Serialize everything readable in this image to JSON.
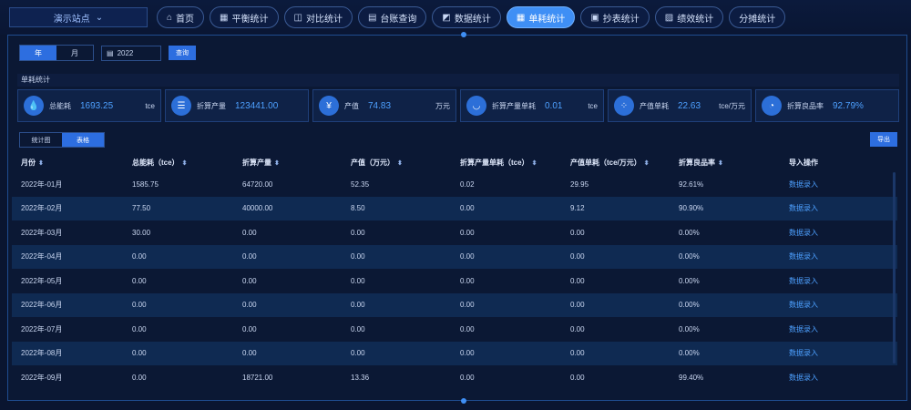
{
  "site": {
    "label": "演示站点",
    "chevron": "chevron-down-icon"
  },
  "nav": [
    {
      "label": "首页",
      "icon": "home-icon",
      "glyph": "⌂",
      "active": false
    },
    {
      "label": "平衡统计",
      "icon": "grid-icon",
      "glyph": "▦",
      "active": false
    },
    {
      "label": "对比统计",
      "icon": "compare-icon",
      "glyph": "◫",
      "active": false
    },
    {
      "label": "台账查询",
      "icon": "ledger-icon",
      "glyph": "▤",
      "active": false
    },
    {
      "label": "数据统计",
      "icon": "chart-icon",
      "glyph": "◩",
      "active": false
    },
    {
      "label": "单耗统计",
      "icon": "grid-icon",
      "glyph": "▦",
      "active": true
    },
    {
      "label": "抄表统计",
      "icon": "meter-icon",
      "glyph": "▣",
      "active": false
    },
    {
      "label": "绩效统计",
      "icon": "image-icon",
      "glyph": "▨",
      "active": false
    },
    {
      "label": "分摊统计",
      "icon": "",
      "glyph": "",
      "active": false
    }
  ],
  "filters": {
    "year_label": "年",
    "month_label": "月",
    "year_value": "2022",
    "query_label": "查询"
  },
  "section_title": "单耗统计",
  "cards": [
    {
      "label": "总能耗",
      "value": "1693.25",
      "unit": "tce",
      "icon": "drop-icon",
      "glyph": "💧"
    },
    {
      "label": "折算产量",
      "value": "123441.00",
      "unit": "",
      "icon": "server-icon",
      "glyph": "☰"
    },
    {
      "label": "产值",
      "value": "74.83",
      "unit": "万元",
      "icon": "yen-icon",
      "glyph": "¥"
    },
    {
      "label": "折算产量单耗",
      "value": "0.01",
      "unit": "tce",
      "icon": "bowl-icon",
      "glyph": "◡"
    },
    {
      "label": "产值单耗",
      "value": "22.63",
      "unit": "tce/万元",
      "icon": "dots-icon",
      "glyph": "⁘"
    },
    {
      "label": "折算良品率",
      "value": "92.79%",
      "unit": "",
      "icon": "pie-icon",
      "glyph": "◔"
    }
  ],
  "tabs": {
    "chart_label": "统计图",
    "table_label": "表格"
  },
  "export_label": "导出",
  "table": {
    "headers": [
      "月份",
      "总能耗（tce）",
      "折算产量",
      "产值（万元）",
      "折算产量单耗（tce）",
      "产值单耗（tce/万元）",
      "折算良品率",
      "导入操作"
    ],
    "rows": [
      [
        "2022年-01月",
        "1585.75",
        "64720.00",
        "52.35",
        "0.02",
        "29.95",
        "92.61%",
        "数据录入"
      ],
      [
        "2022年-02月",
        "77.50",
        "40000.00",
        "8.50",
        "0.00",
        "9.12",
        "90.90%",
        "数据录入"
      ],
      [
        "2022年-03月",
        "30.00",
        "0.00",
        "0.00",
        "0.00",
        "0.00",
        "0.00%",
        "数据录入"
      ],
      [
        "2022年-04月",
        "0.00",
        "0.00",
        "0.00",
        "0.00",
        "0.00",
        "0.00%",
        "数据录入"
      ],
      [
        "2022年-05月",
        "0.00",
        "0.00",
        "0.00",
        "0.00",
        "0.00",
        "0.00%",
        "数据录入"
      ],
      [
        "2022年-06月",
        "0.00",
        "0.00",
        "0.00",
        "0.00",
        "0.00",
        "0.00%",
        "数据录入"
      ],
      [
        "2022年-07月",
        "0.00",
        "0.00",
        "0.00",
        "0.00",
        "0.00",
        "0.00%",
        "数据录入"
      ],
      [
        "2022年-08月",
        "0.00",
        "0.00",
        "0.00",
        "0.00",
        "0.00",
        "0.00%",
        "数据录入"
      ],
      [
        "2022年-09月",
        "0.00",
        "18721.00",
        "13.36",
        "0.00",
        "0.00",
        "99.40%",
        "数据录入"
      ]
    ]
  },
  "colors": {
    "accent": "#3f8ff5",
    "value": "#4da0ff",
    "background": "#0a1530"
  }
}
